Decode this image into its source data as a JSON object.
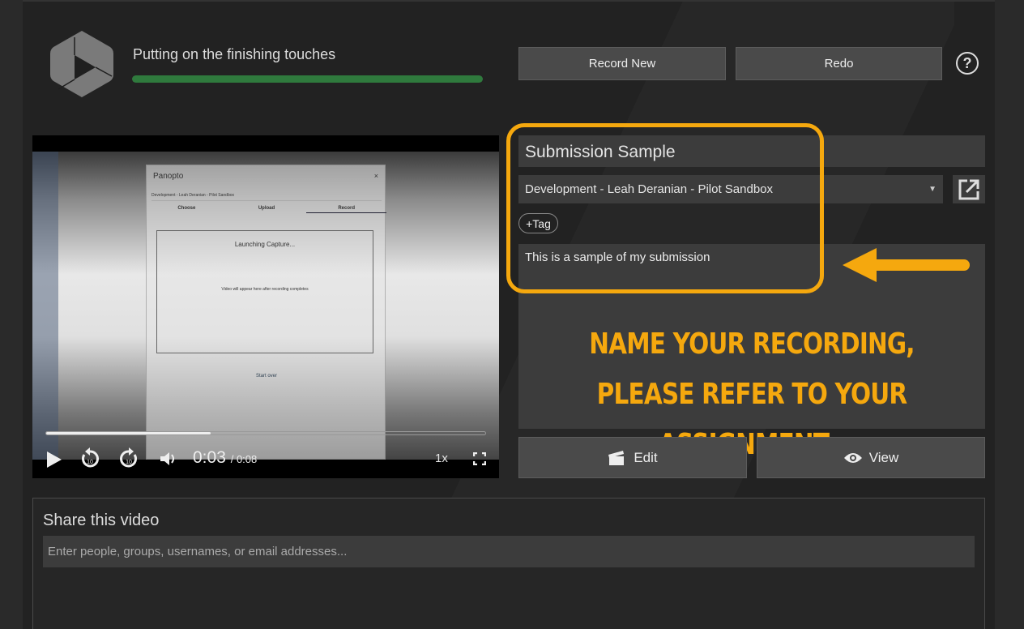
{
  "header": {
    "status": "Putting on the finishing touches",
    "progress_percent": 100,
    "progress_color": "#2f7a3d",
    "record_new": "Record New",
    "redo": "Redo",
    "help_icon": "?"
  },
  "video": {
    "thumbnail": {
      "dialog_title": "Panopto",
      "close": "×",
      "folder": "Development - Leah Deranian - Pilot Sandbox",
      "tabs": [
        "Choose",
        "Upload",
        "Record"
      ],
      "launching": "Launching Capture...",
      "placeholder": "Video will appear here after recording completes",
      "start_over": "Start over"
    },
    "current_time": "0:03",
    "duration": "/ 0:08",
    "played_fraction": 0.375,
    "speed": "1x"
  },
  "form": {
    "title": "Submission Sample",
    "folder": "Development - Leah Deranian - Pilot Sandbox",
    "tag_label": "+Tag",
    "description": "This is a sample of my submission",
    "edit": "Edit",
    "view": "View"
  },
  "annotation": {
    "note": "Name your recording, please refer to your assignment .",
    "color": "#f5a80e"
  },
  "share": {
    "heading": "Share this video",
    "placeholder": "Enter people, groups, usernames, or email addresses..."
  }
}
